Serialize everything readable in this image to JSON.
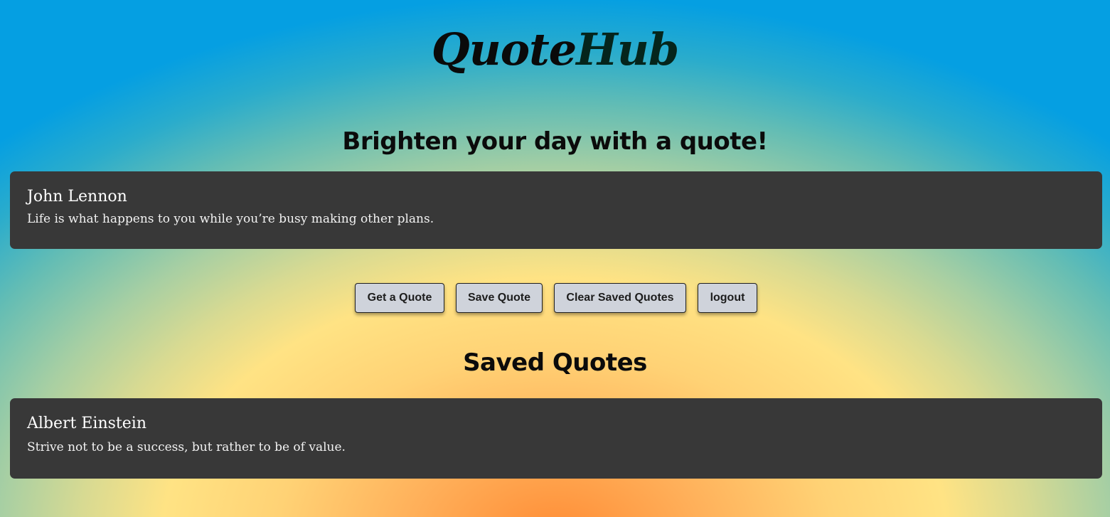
{
  "app": {
    "logo_part1": "Quote",
    "logo_part2": "Hub"
  },
  "main": {
    "heading": "Brighten your day with a quote!",
    "current_quote": {
      "author": "John Lennon",
      "text": "Life is what happens to you while you’re busy making other plans."
    }
  },
  "actions": {
    "get_quote": "Get a Quote",
    "save_quote": "Save Quote",
    "clear_saved": "Clear Saved Quotes",
    "logout": "logout"
  },
  "saved": {
    "heading": "Saved Quotes",
    "quotes": [
      {
        "author": "Albert Einstein",
        "text": "Strive not to be a success, but rather to be of value."
      }
    ]
  },
  "colors": {
    "card_background": "#383838",
    "button_background": "#cfd3db",
    "logo_hub": "#05251c"
  }
}
